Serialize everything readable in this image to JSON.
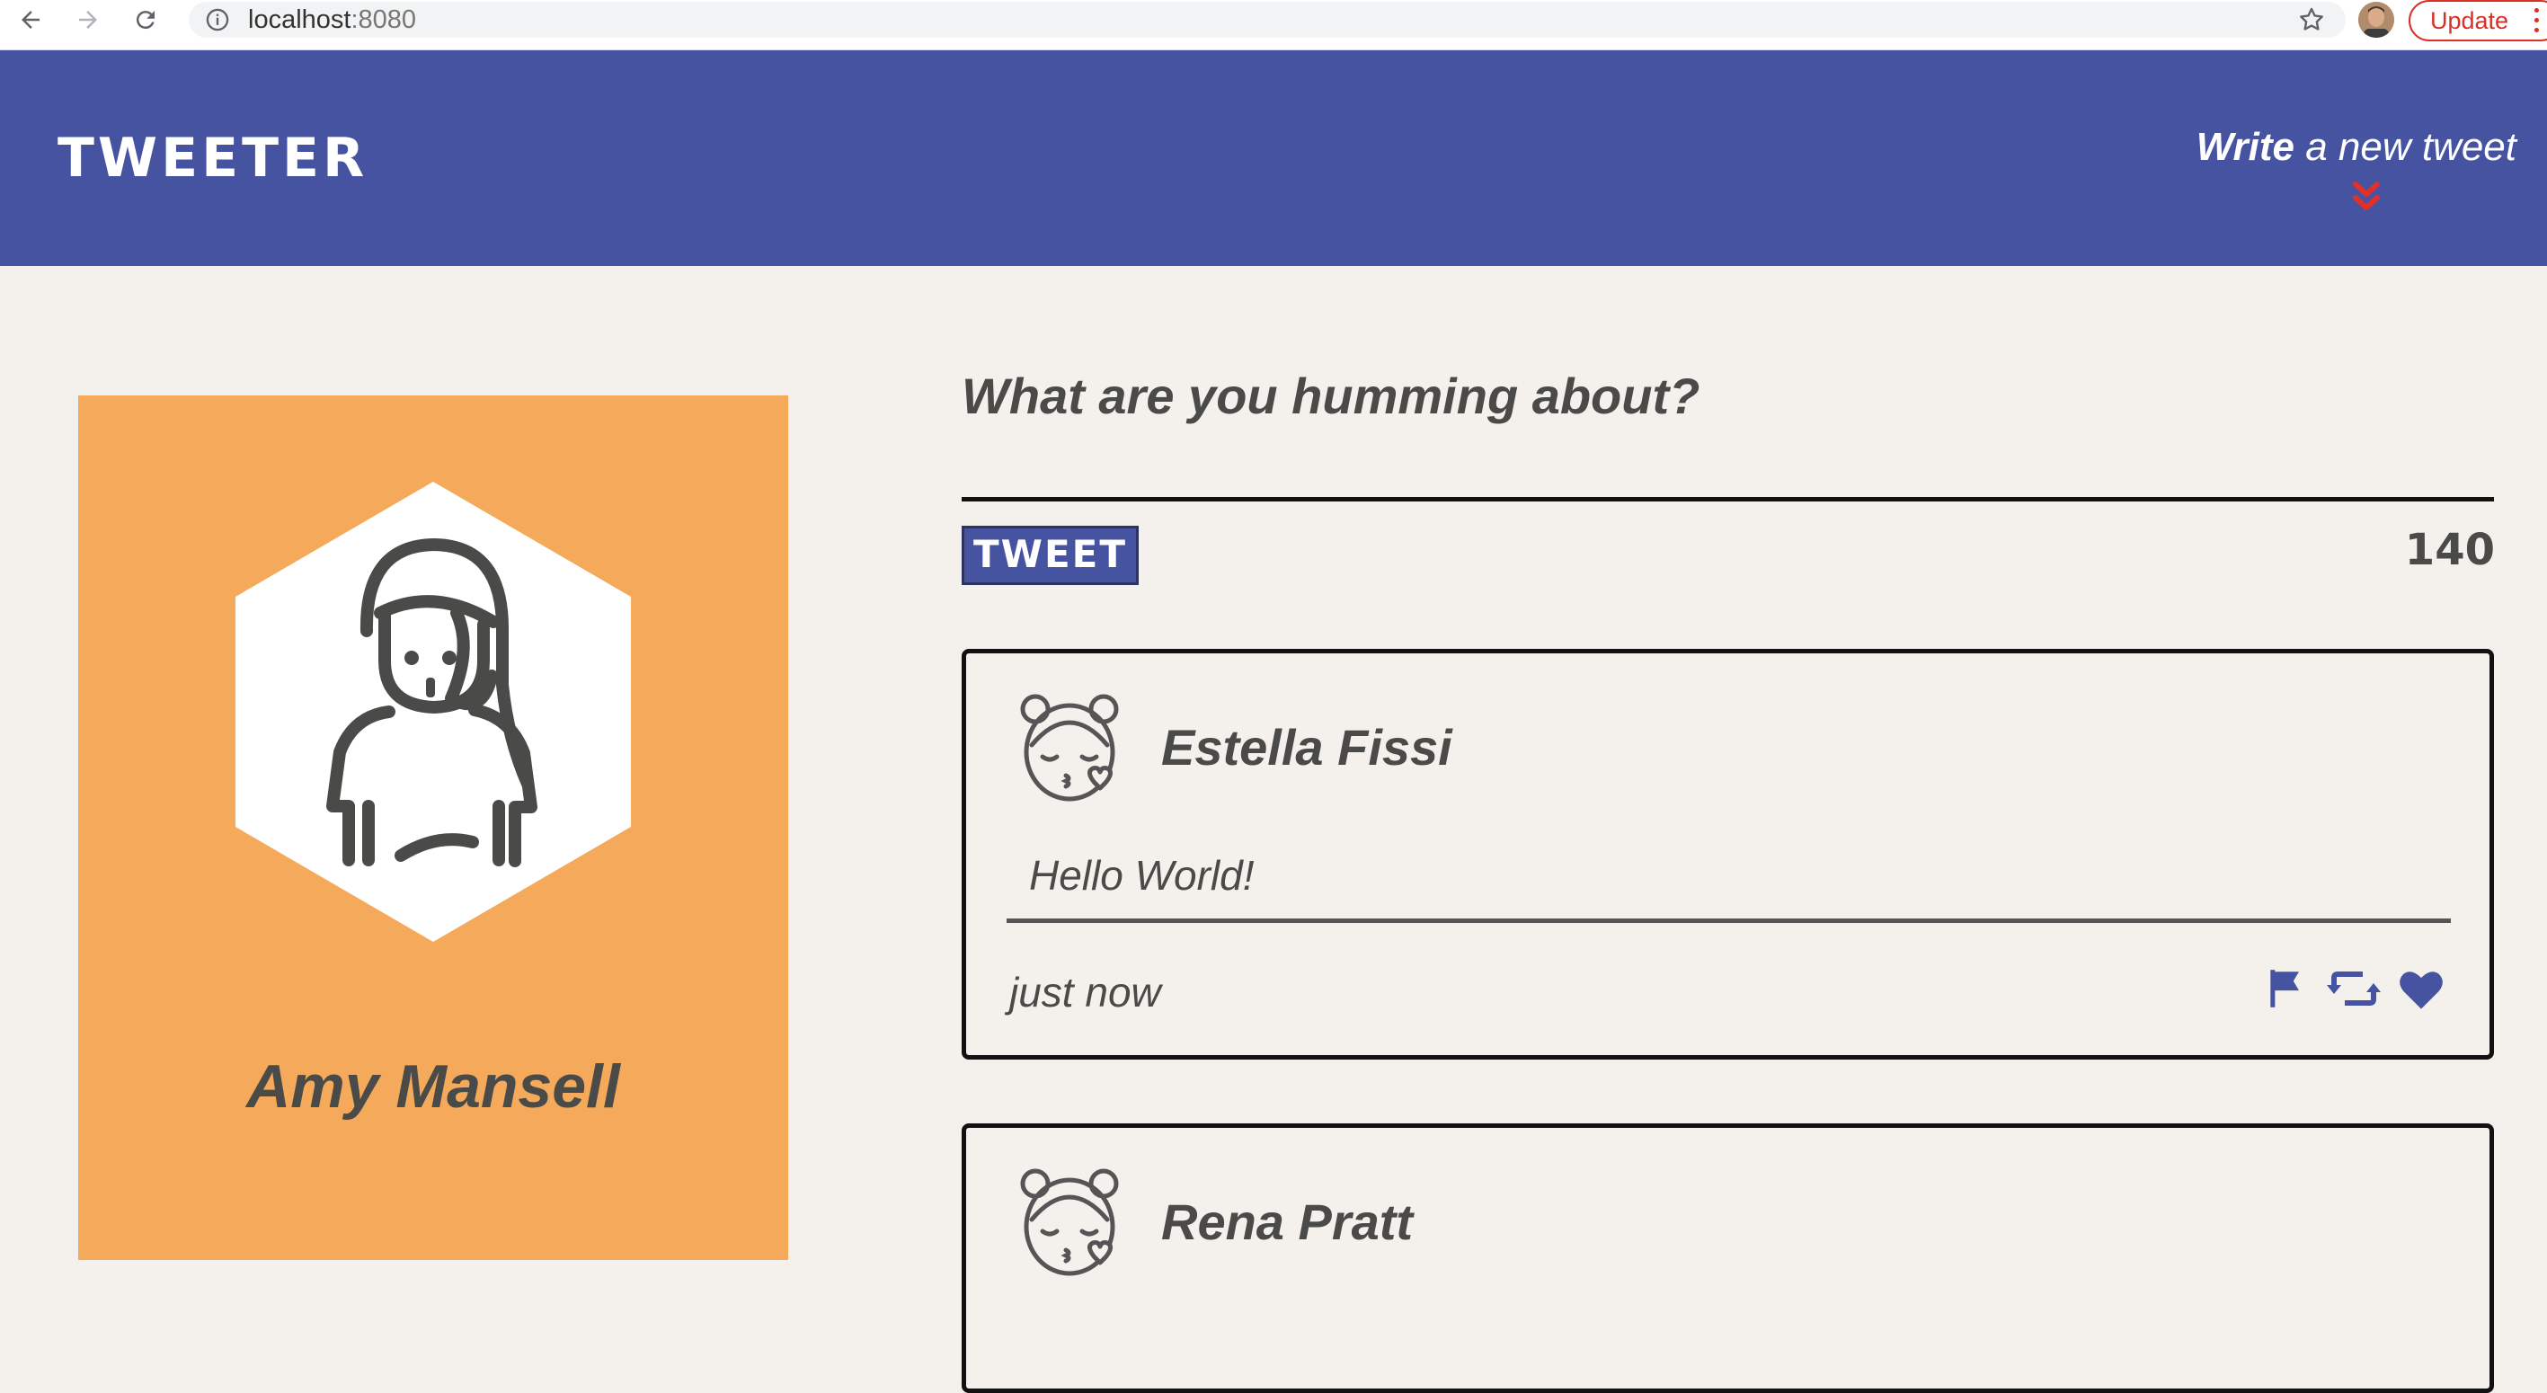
{
  "browser": {
    "url_host": "localhost",
    "url_port": ":8080",
    "update_label": "Update",
    "icons": [
      "back-arrow-icon",
      "forward-arrow-icon",
      "reload-icon",
      "info-icon",
      "star-icon"
    ]
  },
  "header": {
    "brand": "TWEETER",
    "write_bold": "Write",
    "write_rest": " a new tweet",
    "toggle_icon": "double-chevron-down-icon"
  },
  "profile": {
    "name": "Amy Mansell",
    "background_color": "#f4aa5a",
    "avatar_icon": "woman-avatar-icon"
  },
  "compose": {
    "prompt": "What are you humming about?",
    "submit_label": "TWEET",
    "char_counter": "140"
  },
  "tweets": [
    {
      "name": "Estella Fissi",
      "text": "Hello World!",
      "time": "just now",
      "avatar_icon": "kissing-girl-avatar-icon",
      "actions": [
        "flag-icon",
        "retweet-icon",
        "heart-icon"
      ]
    },
    {
      "name": "Rena Pratt",
      "avatar_icon": "kissing-girl-avatar-icon"
    }
  ],
  "colors": {
    "header": "#4553a0",
    "page_background": "#f4f1ec",
    "accent_red": "#e0302c",
    "text": "#4a4a48"
  }
}
